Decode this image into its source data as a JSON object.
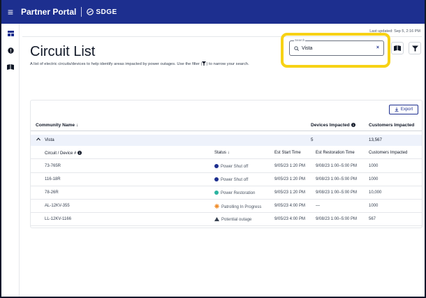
{
  "topbar": {
    "app_title": "Partner Portal",
    "brand": "SDGE"
  },
  "sidebar": {
    "items": [
      {
        "icon": "dashboard-icon"
      },
      {
        "icon": "alert-icon"
      },
      {
        "icon": "map-book-icon"
      }
    ]
  },
  "page": {
    "last_updated": "Last updated: Sep 5, 2:16 PM",
    "title": "Circuit List",
    "description_before": "A list of electric circuits/devices to help identify areas impacted by power outages. Use the filter (",
    "description_after": ") to narrow your search."
  },
  "search": {
    "label": "Search",
    "value": "Vista",
    "clear": "×"
  },
  "export": {
    "label": "Export"
  },
  "table": {
    "headers": {
      "community": "Community Name ↓",
      "devices": "Devices Impacted",
      "customers": "Customers Impacted"
    },
    "group": {
      "name": "Vista",
      "devices": "5",
      "customers": "13,567"
    },
    "sub_headers": {
      "circuit": "Circuit / Device #",
      "status": "Status ↓",
      "start": "Est Start Time",
      "restoration": "Est Restoration Time",
      "customers": "Customers Impacted"
    },
    "rows": [
      {
        "circuit": "73-765R",
        "status": "Power Shut off",
        "start": "9/05/23 1:20 PM",
        "restoration": "9/08/23 1:00–5:00 PM",
        "customers": "1000"
      },
      {
        "circuit": "116-18R",
        "status": "Power Shut off",
        "start": "9/05/23 1:20 PM",
        "restoration": "9/08/23 1:00–5:00 PM",
        "customers": "1000"
      },
      {
        "circuit": "78-26R",
        "status": "Power Restoration",
        "start": "9/05/23 1:20 PM",
        "restoration": "9/08/23 1:00–5:00 PM",
        "customers": "10,000"
      },
      {
        "circuit": "AL-12KV-355",
        "status": "Patrolling In Progress",
        "start": "9/05/23 4:00 PM",
        "restoration": "—",
        "customers": "1000"
      },
      {
        "circuit": "LL-12KV-1166",
        "status": "Potential outage",
        "start": "9/05/23 4:00 PM",
        "restoration": "9/08/23 1:00–5:00 PM",
        "customers": "567"
      }
    ]
  },
  "colors": {
    "brand_navy": "#1d2f8f",
    "highlight_yellow": "#f7d215",
    "shut_off_blue": "#1d2f8f",
    "restoration_teal": "#2bb3a0",
    "patrolling_orange": "#f08c2a",
    "potential_dark": "#374151"
  }
}
